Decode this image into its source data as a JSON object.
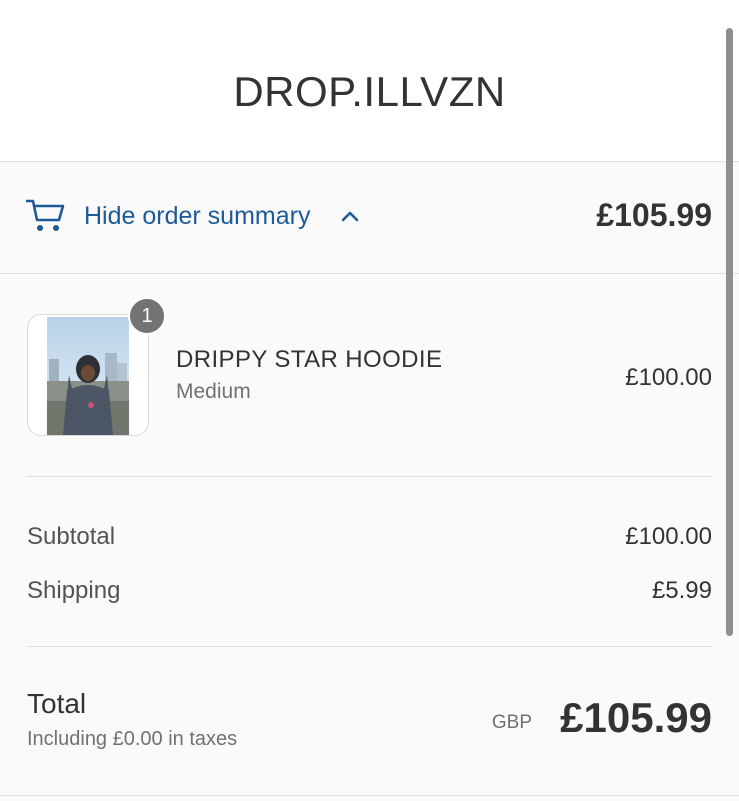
{
  "header": {
    "brand": "DROP.ILLVZN"
  },
  "summary_toggle": {
    "icon": "cart-icon",
    "label": "Hide order summary",
    "chevron": "chevron-up-icon",
    "total": "£105.99"
  },
  "product": {
    "quantity": "1",
    "name": "DRIPPY STAR HOODIE",
    "variant": "Medium",
    "price": "£100.00"
  },
  "lines": {
    "subtotal_label": "Subtotal",
    "subtotal_value": "£100.00",
    "shipping_label": "Shipping",
    "shipping_value": "£5.99"
  },
  "total": {
    "label": "Total",
    "tax_note": "Including £0.00 in taxes",
    "currency": "GBP",
    "value": "£105.99"
  },
  "colors": {
    "link": "#1c5a99",
    "text": "#333333",
    "muted": "#717171",
    "panel": "#fafafa",
    "border": "#dedede"
  }
}
